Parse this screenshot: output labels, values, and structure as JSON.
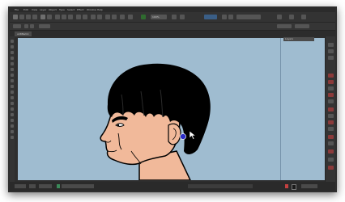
{
  "menu": [
    "File",
    "Edit",
    "View",
    "Layer",
    "Object",
    "Type",
    "Select",
    "Effect",
    "Window",
    "Help"
  ],
  "toolbar": {
    "zoom_value": "100%"
  },
  "document_tab": {
    "label": "untitled-1"
  },
  "workspace": {
    "panel_tab_label": "Layers"
  },
  "colors": {
    "artboard": "#9fbcd0",
    "skin": "#f1b99a",
    "hair": "#000000",
    "cursor_marker": "#2a2cc8"
  }
}
